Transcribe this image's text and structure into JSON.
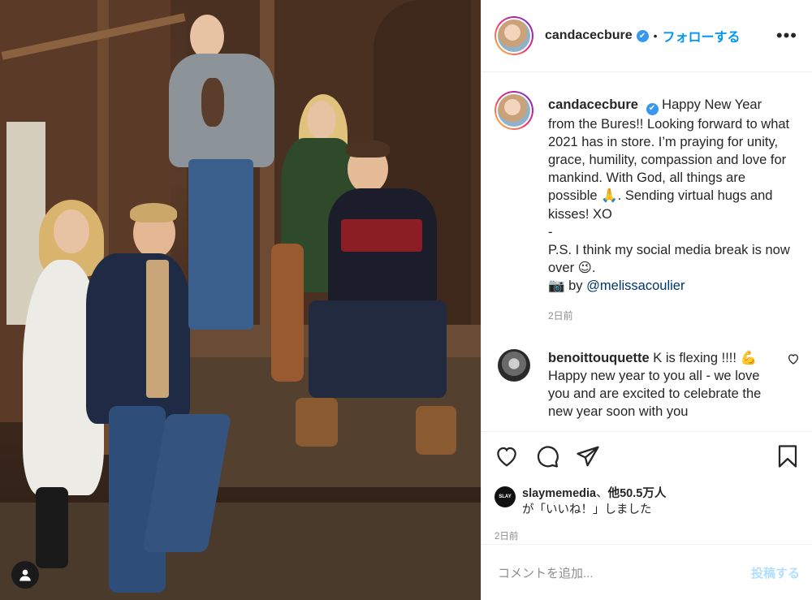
{
  "post": {
    "author": "candacecbure",
    "verified_glyph": "✔",
    "header_separator": "•",
    "follow_label": "フォローする",
    "more_label": "•••"
  },
  "caption": {
    "username": "candacecbure",
    "text_1": "Happy New Year from the Bures!! Looking forward to what 2021 has in store. I’m praying for unity, grace, humility, compassion and love for mankind. With God, all things are possible 🙏. Sending virtual hugs and kisses! XO",
    "dash": "-",
    "text_2": "P.S. I think my social media break is now over 😉.",
    "credit_prefix": "📷 by",
    "credit_mention": "@melissacoulier",
    "time": "2日前"
  },
  "comment": {
    "username": "benoittouquette",
    "text": "K is flexing !!!! 💪 Happy new year to you all - we love you and are excited to celebrate the new year soon with you"
  },
  "likes": {
    "avatar_text": "SLAY",
    "user": "slaymemedia",
    "joiner": "、",
    "others": "他50.5万人",
    "suffix": "が「いいね！」しました",
    "time": "2日前"
  },
  "add_comment": {
    "placeholder": "コメントを追加...",
    "post_label": "投稿する"
  },
  "icons": {
    "like": "heart-icon",
    "comment": "comment-icon",
    "share": "paper-plane-icon",
    "save": "bookmark-icon",
    "tag": "user-tag-icon"
  }
}
